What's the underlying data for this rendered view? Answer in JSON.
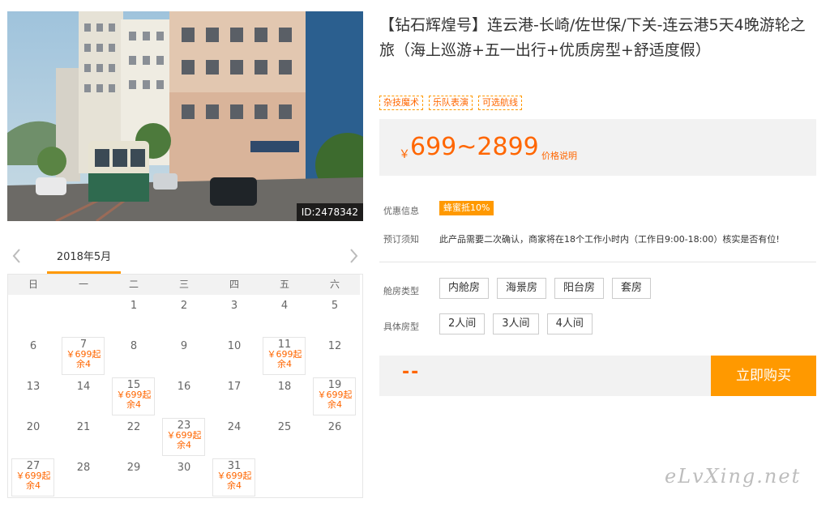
{
  "photo": {
    "id_label": "ID:2478342"
  },
  "calendar": {
    "month_label": "2018年5月",
    "weekdays": [
      "日",
      "一",
      "二",
      "三",
      "四",
      "五",
      "六"
    ],
    "cells": [
      {
        "day": "",
        "price": "",
        "left": ""
      },
      {
        "day": "",
        "price": "",
        "left": ""
      },
      {
        "day": "1",
        "price": "",
        "left": ""
      },
      {
        "day": "2",
        "price": "",
        "left": ""
      },
      {
        "day": "3",
        "price": "",
        "left": ""
      },
      {
        "day": "4",
        "price": "",
        "left": ""
      },
      {
        "day": "5",
        "price": "",
        "left": ""
      },
      {
        "day": "6",
        "price": "",
        "left": ""
      },
      {
        "day": "7",
        "price": "￥699起",
        "left": "余4"
      },
      {
        "day": "8",
        "price": "",
        "left": ""
      },
      {
        "day": "9",
        "price": "",
        "left": ""
      },
      {
        "day": "10",
        "price": "",
        "left": ""
      },
      {
        "day": "11",
        "price": "￥699起",
        "left": "余4"
      },
      {
        "day": "12",
        "price": "",
        "left": ""
      },
      {
        "day": "13",
        "price": "",
        "left": ""
      },
      {
        "day": "14",
        "price": "",
        "left": ""
      },
      {
        "day": "15",
        "price": "￥699起",
        "left": "余4"
      },
      {
        "day": "16",
        "price": "",
        "left": ""
      },
      {
        "day": "17",
        "price": "",
        "left": ""
      },
      {
        "day": "18",
        "price": "",
        "left": ""
      },
      {
        "day": "19",
        "price": "￥699起",
        "left": "余4"
      },
      {
        "day": "20",
        "price": "",
        "left": ""
      },
      {
        "day": "21",
        "price": "",
        "left": ""
      },
      {
        "day": "22",
        "price": "",
        "left": ""
      },
      {
        "day": "23",
        "price": "￥699起",
        "left": "余4"
      },
      {
        "day": "24",
        "price": "",
        "left": ""
      },
      {
        "day": "25",
        "price": "",
        "left": ""
      },
      {
        "day": "26",
        "price": "",
        "left": ""
      },
      {
        "day": "27",
        "price": "￥699起",
        "left": "余4"
      },
      {
        "day": "28",
        "price": "",
        "left": ""
      },
      {
        "day": "29",
        "price": "",
        "left": ""
      },
      {
        "day": "30",
        "price": "",
        "left": ""
      },
      {
        "day": "31",
        "price": "￥699起",
        "left": "余4"
      },
      {
        "day": "",
        "price": "",
        "left": ""
      },
      {
        "day": "",
        "price": "",
        "left": ""
      }
    ]
  },
  "product": {
    "title": "【钻石辉煌号】连云港-长崎/佐世保/下关-连云港5天4晚游轮之旅（海上巡游+五一出行+优质房型+舒适度假）",
    "tags": [
      "杂技魔术",
      "乐队表演",
      "可选航线"
    ],
    "currency": "￥",
    "price_range": "699~2899",
    "price_note": "价格说明"
  },
  "info": {
    "promo_label": "优惠信息",
    "promo_badge": "蜂蜜抵10%",
    "notice_label": "预订须知",
    "notice_text": "此产品需要二次确认，商家将在18个工作小时内（工作日9:00-18:00）核实是否有位!"
  },
  "cabin": {
    "label": "舱房类型",
    "options": [
      "内舱房",
      "海景房",
      "阳台房",
      "套房"
    ]
  },
  "room": {
    "label": "具体房型",
    "options": [
      "2人间",
      "3人间",
      "4人间"
    ]
  },
  "purchase": {
    "total": "--",
    "buy_label": "立即购买"
  },
  "watermark": "eLvXing.net",
  "colors": {
    "accent": "#ff9900",
    "price": "#ff6600",
    "panel": "#f2f2f2"
  }
}
